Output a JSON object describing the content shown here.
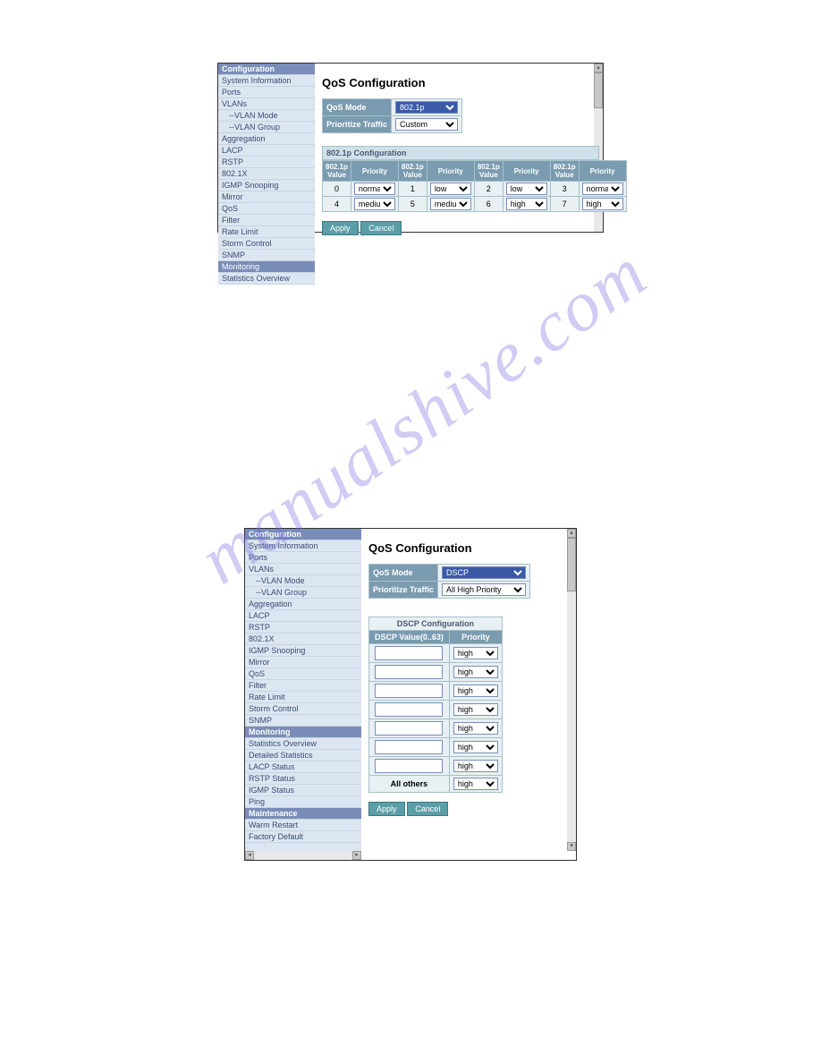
{
  "watermark": "manualshive.com",
  "panel1": {
    "sidebar": {
      "categories": [
        {
          "label": "Configuration",
          "type": "cat"
        },
        {
          "label": "System Information",
          "type": "item"
        },
        {
          "label": "Ports",
          "type": "item"
        },
        {
          "label": "VLANs",
          "type": "item"
        },
        {
          "label": "--VLAN Mode",
          "type": "sub"
        },
        {
          "label": "--VLAN Group",
          "type": "sub"
        },
        {
          "label": "Aggregation",
          "type": "item"
        },
        {
          "label": "LACP",
          "type": "item"
        },
        {
          "label": "RSTP",
          "type": "item"
        },
        {
          "label": "802.1X",
          "type": "item"
        },
        {
          "label": "IGMP Snooping",
          "type": "item"
        },
        {
          "label": "Mirror",
          "type": "item"
        },
        {
          "label": "QoS",
          "type": "item"
        },
        {
          "label": "Filter",
          "type": "item"
        },
        {
          "label": "Rate Limit",
          "type": "item"
        },
        {
          "label": "Storm Control",
          "type": "item"
        },
        {
          "label": "SNMP",
          "type": "item"
        },
        {
          "label": "Monitoring",
          "type": "hl"
        },
        {
          "label": "Statistics Overview",
          "type": "item"
        }
      ]
    },
    "title": "QoS Configuration",
    "qos_mode_label": "QoS Mode",
    "qos_mode_value": "802.1p",
    "prioritize_label": "Prioritize Traffic",
    "prioritize_value": "Custom",
    "section_header": "802.1p Configuration",
    "col_value": "802.1p Value",
    "col_priority": "Priority",
    "rows": [
      {
        "v0": "0",
        "p0": "normal",
        "v1": "1",
        "p1": "low",
        "v2": "2",
        "p2": "low",
        "v3": "3",
        "p3": "normal"
      },
      {
        "v0": "4",
        "p0": "medium",
        "v1": "5",
        "p1": "medium",
        "v2": "6",
        "p2": "high",
        "v3": "7",
        "p3": "high"
      }
    ],
    "apply": "Apply",
    "cancel": "Cancel"
  },
  "panel2": {
    "sidebar": {
      "categories": [
        {
          "label": "Configuration",
          "type": "cat"
        },
        {
          "label": "System Information",
          "type": "item"
        },
        {
          "label": "Ports",
          "type": "item"
        },
        {
          "label": "VLANs",
          "type": "item"
        },
        {
          "label": "--VLAN Mode",
          "type": "sub"
        },
        {
          "label": "--VLAN Group",
          "type": "sub"
        },
        {
          "label": "Aggregation",
          "type": "item"
        },
        {
          "label": "LACP",
          "type": "item"
        },
        {
          "label": "RSTP",
          "type": "item"
        },
        {
          "label": "802.1X",
          "type": "item"
        },
        {
          "label": "IGMP Snooping",
          "type": "item"
        },
        {
          "label": "Mirror",
          "type": "item"
        },
        {
          "label": "QoS",
          "type": "item"
        },
        {
          "label": "Filter",
          "type": "item"
        },
        {
          "label": "Rate Limit",
          "type": "item"
        },
        {
          "label": "Storm Control",
          "type": "item"
        },
        {
          "label": "SNMP",
          "type": "item"
        },
        {
          "label": "Monitoring",
          "type": "cat"
        },
        {
          "label": "Statistics Overview",
          "type": "item"
        },
        {
          "label": "Detailed Statistics",
          "type": "item"
        },
        {
          "label": "LACP Status",
          "type": "item"
        },
        {
          "label": "RSTP Status",
          "type": "item"
        },
        {
          "label": "IGMP Status",
          "type": "item"
        },
        {
          "label": "Ping",
          "type": "item"
        },
        {
          "label": "Maintenance",
          "type": "cat"
        },
        {
          "label": "Warm Restart",
          "type": "item"
        },
        {
          "label": "Factory Default",
          "type": "item"
        }
      ]
    },
    "title": "QoS Configuration",
    "qos_mode_label": "QoS Mode",
    "qos_mode_value": "DSCP",
    "prioritize_label": "Prioritize Traffic",
    "prioritize_value": "All High Priority",
    "dscp_caption": "DSCP Configuration",
    "dscp_col_value": "DSCP Value(0..63)",
    "dscp_col_priority": "Priority",
    "dscp_rows": [
      {
        "value": "",
        "priority": "high"
      },
      {
        "value": "",
        "priority": "high"
      },
      {
        "value": "",
        "priority": "high"
      },
      {
        "value": "",
        "priority": "high"
      },
      {
        "value": "",
        "priority": "high"
      },
      {
        "value": "",
        "priority": "high"
      },
      {
        "value": "",
        "priority": "high"
      }
    ],
    "all_others_label": "All others",
    "all_others_priority": "high",
    "apply": "Apply",
    "cancel": "Cancel"
  }
}
